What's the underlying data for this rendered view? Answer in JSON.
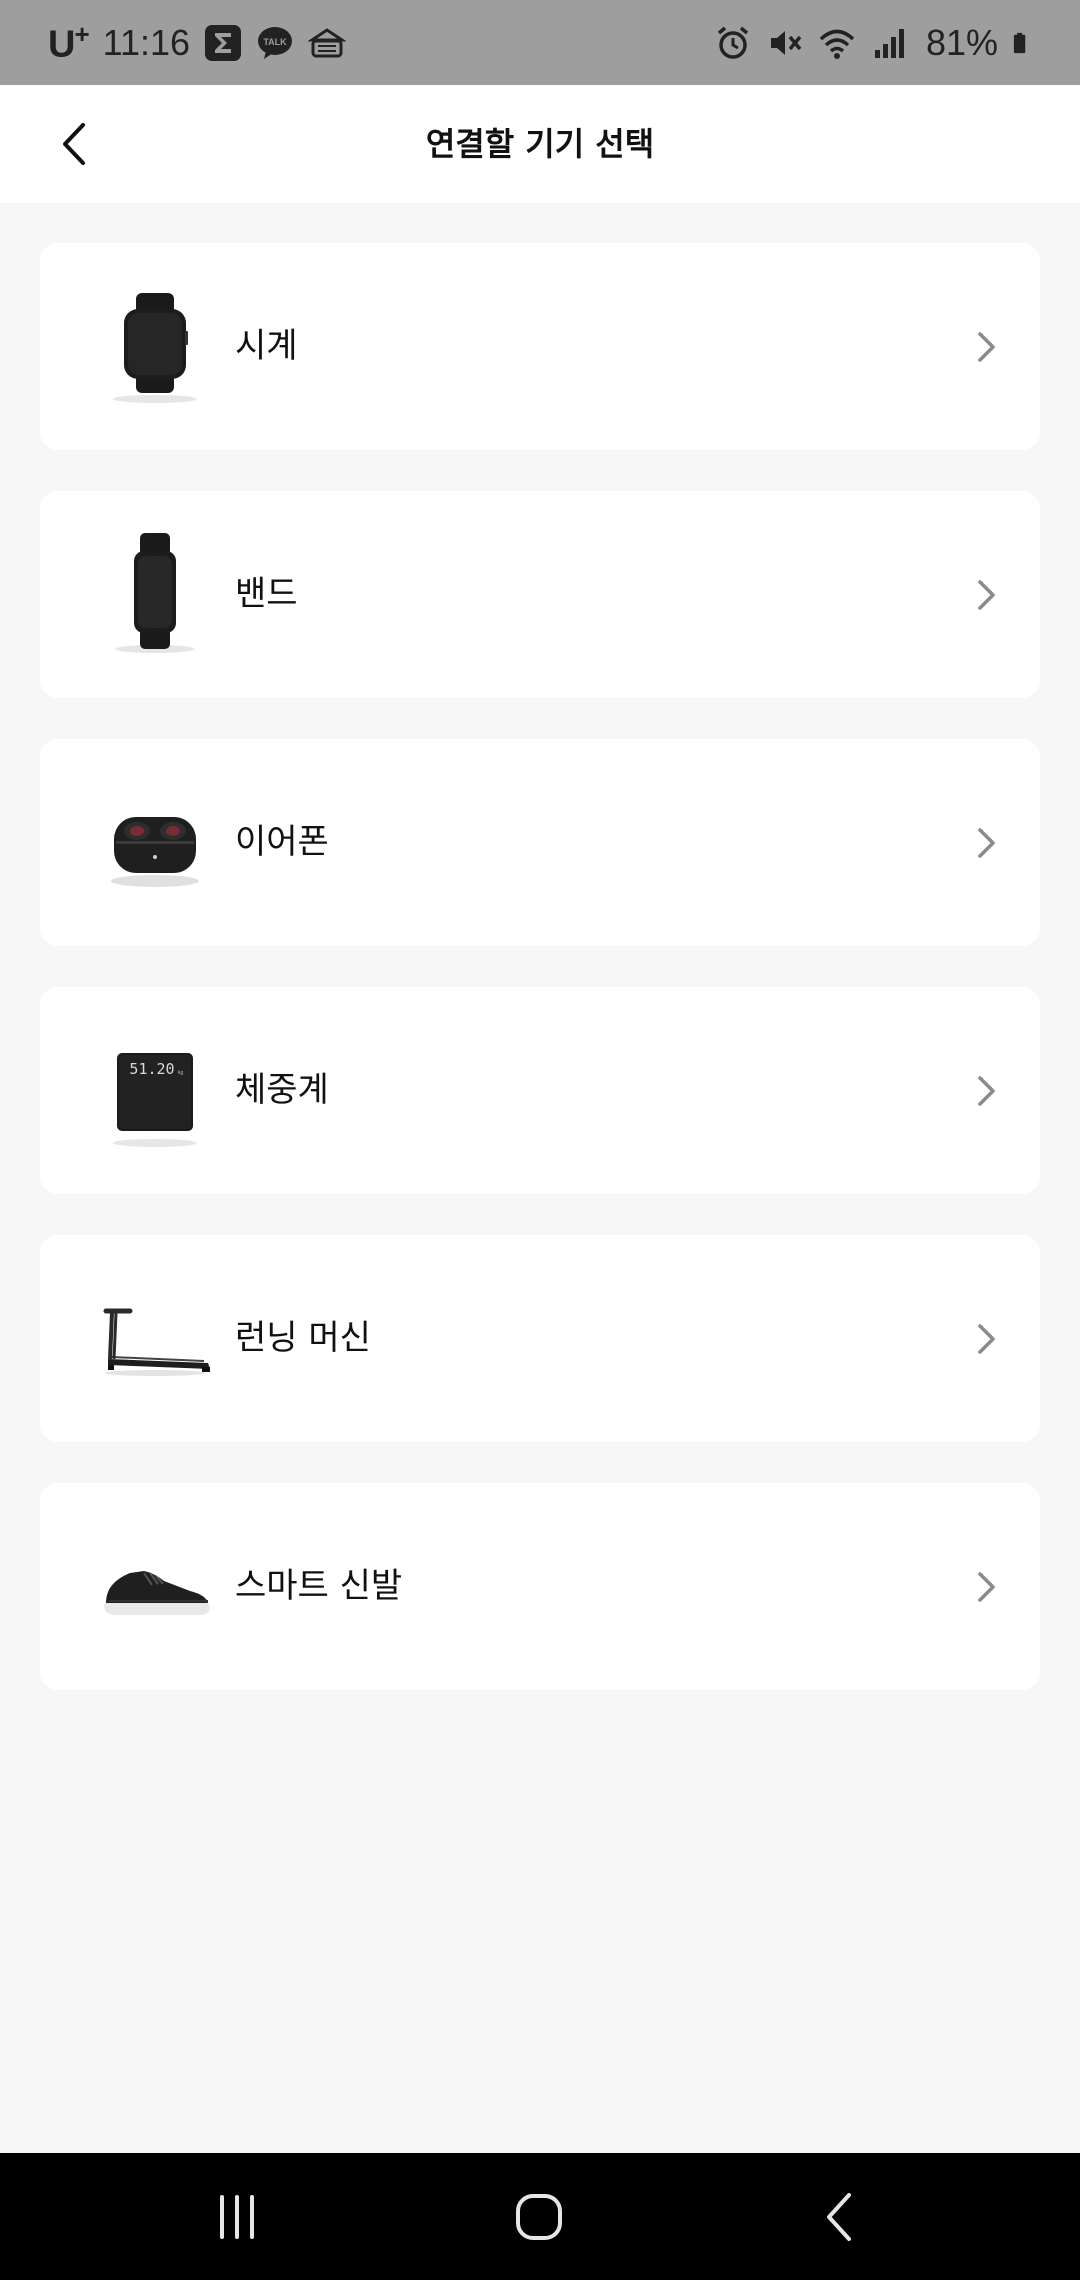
{
  "status_bar": {
    "carrier": "U",
    "carrier_mark": "+",
    "time": "11:16",
    "icons": [
      "sigma-app-icon",
      "kakaotalk-icon",
      "bank-app-icon",
      "alarm-icon",
      "mute-icon",
      "wifi-icon",
      "signal-icon",
      "battery-icon"
    ],
    "battery_percent": "81%"
  },
  "header": {
    "title": "연결할 기기 선택",
    "back_icon": "back-arrow-icon"
  },
  "devices": [
    {
      "label": "시계",
      "icon": "smartwatch-image"
    },
    {
      "label": "밴드",
      "icon": "fitness-band-image"
    },
    {
      "label": "이어폰",
      "icon": "earbuds-image"
    },
    {
      "label": "체중계",
      "icon": "scale-image",
      "scale_reading": "51.20"
    },
    {
      "label": "런닝 머신",
      "icon": "treadmill-image"
    },
    {
      "label": "스마트 신발",
      "icon": "smart-shoe-image"
    }
  ],
  "nav_bar": {
    "buttons": [
      "recents-icon",
      "home-icon",
      "back-icon"
    ]
  },
  "colors": {
    "status_bar_bg": "#9e9e9e",
    "header_bg": "#ffffff",
    "page_bg": "#f7f7f7",
    "card_bg": "#ffffff",
    "chevron": "#8a8a8a",
    "nav_bar_bg": "#000000"
  }
}
